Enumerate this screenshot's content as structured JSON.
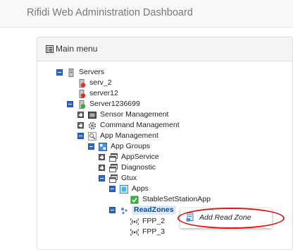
{
  "app": {
    "title": "Rifidi Web Administration Dashboard"
  },
  "panel": {
    "title": "Main menu"
  },
  "tree": {
    "servers": "Servers",
    "serv_2": "serv_2",
    "server12": "server12",
    "server1236699": "Server1236699",
    "sensor_management": "Sensor Management",
    "command_management": "Command Management",
    "app_management": "App Management",
    "app_groups": "App Groups",
    "appservice": "AppService",
    "diagnostic": "Diagnostic",
    "gtux": "Gtux",
    "apps": "Apps",
    "stable_app": "StableSetStationApp",
    "readzones": "ReadZones",
    "fpp_2": "FPP_2",
    "fpp_3": "FPP_3"
  },
  "context_menu": {
    "add_read_zone": "Add Read Zone"
  },
  "colors": {
    "accent": "#2f68c8",
    "highlight": "#e01515"
  }
}
